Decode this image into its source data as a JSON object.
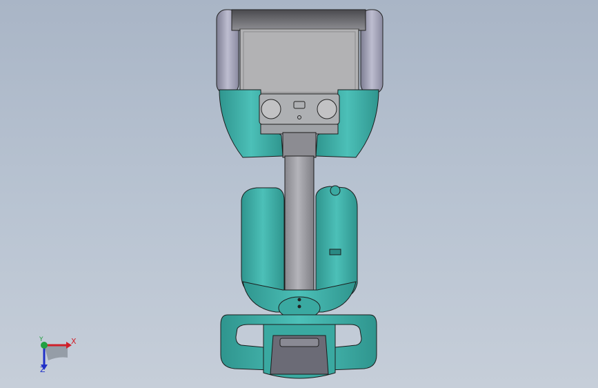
{
  "viewport": {
    "title": "",
    "background_top": "#a9b5c6",
    "background_bottom": "#c6ced9"
  },
  "model": {
    "name": "",
    "body_color": "#3fb2aa",
    "body_dark_color": "#2a8a84",
    "tray_color": "#b0b0b0",
    "wheel_color": "#a3a3b8",
    "handle_pad_color": "#6b6b76",
    "pole_color": "#9a9aa0"
  },
  "triad": {
    "x_label": "X",
    "y_label": "Y",
    "z_label": "Z",
    "x_color": "#d0202a",
    "y_color": "#22a040",
    "z_color": "#2030c8"
  }
}
